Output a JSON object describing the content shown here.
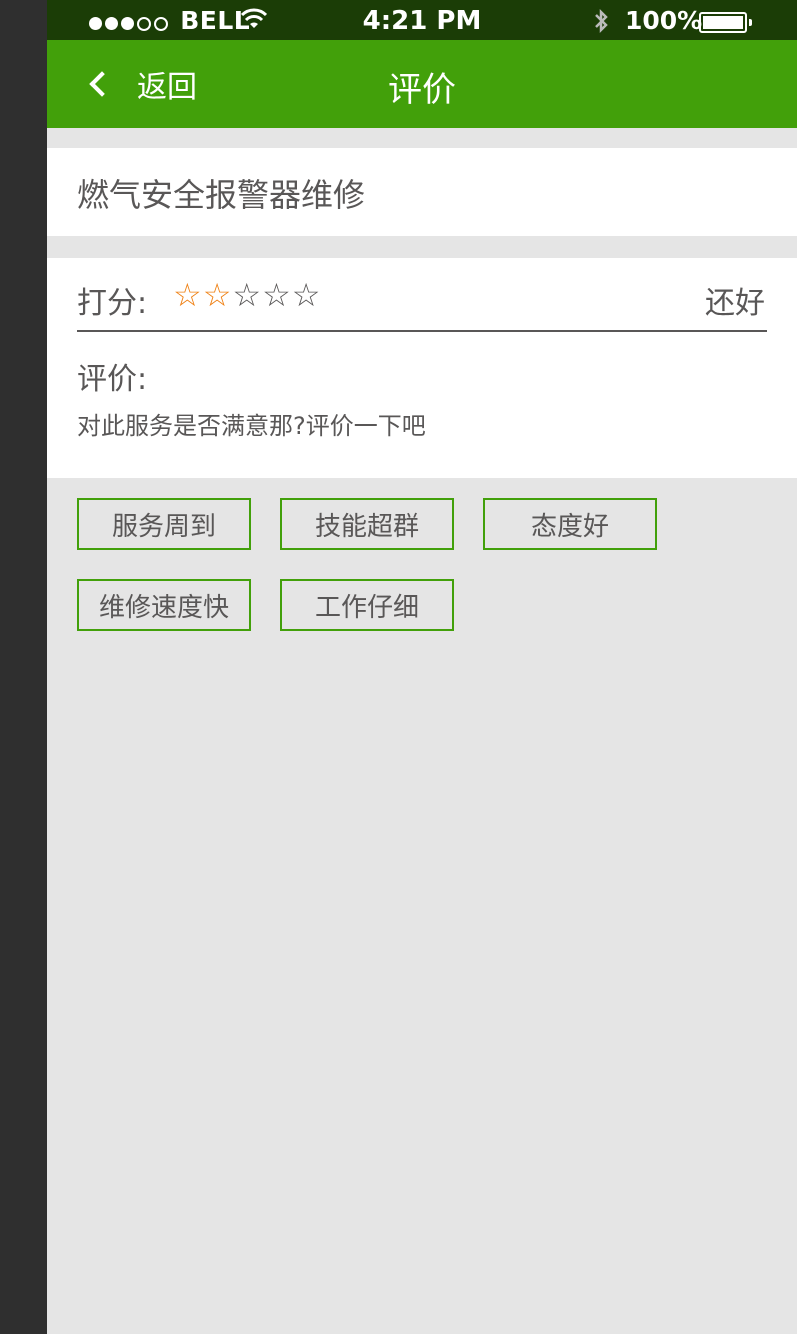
{
  "colors": {
    "brand_green": "#42a00a",
    "text_gray": "#595757",
    "star_orange": "#ef8013",
    "page_bg": "#e5e5e5"
  },
  "status_bar": {
    "carrier": "BELL",
    "time": "4:21 PM",
    "battery": "100%",
    "signal_icon": "signal-dots-icon",
    "wifi_icon": "wifi-icon",
    "bluetooth_icon": "bluetooth-icon",
    "battery_icon": "battery-icon"
  },
  "nav": {
    "back_icon": "chevron-left-icon",
    "back_label": "返回",
    "title": "评价"
  },
  "service": {
    "name": "燃气安全报警器维修"
  },
  "rating": {
    "label": "打分:",
    "filled_stars": 2,
    "max_stars": 5,
    "star_glyph_on": "☆",
    "star_glyph_off": "☆",
    "score_word": "还好"
  },
  "review": {
    "label": "评价:",
    "placeholder": "对此服务是否满意那?评价一下吧"
  },
  "tags": [
    "服务周到",
    "技能超群",
    "态度好",
    "维修速度快",
    "工作仔细"
  ]
}
